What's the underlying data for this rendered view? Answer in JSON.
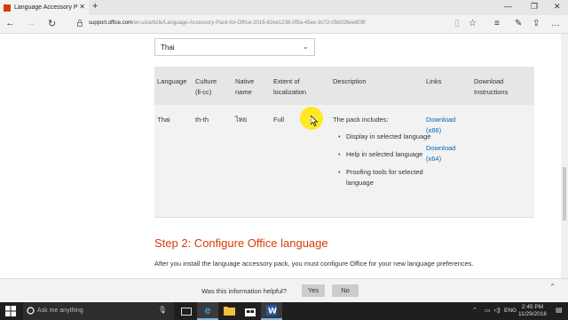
{
  "browser": {
    "tab_title": "Language Accessory Pack",
    "url_domain": "support.office.com",
    "url_path": "/en-us/article/Language-Accessory-Pack-for-Office-2016-82ee1236-0f9a-45ee-9c72-05b026ee809f"
  },
  "page": {
    "language_select": "Thai",
    "table": {
      "headers": [
        "Language",
        "Culture (ll-cc)",
        "Native name",
        "Extent of localization",
        "Description",
        "Links",
        "Download Instructions"
      ],
      "row": {
        "language": "Thai",
        "culture": "th-th",
        "native_name": "ไทย",
        "extent": "Full",
        "description_intro": "The pack includes:",
        "description_items": [
          "Display in selected language",
          "Help in selected language",
          "Proofing tools for selected language"
        ],
        "link_x86": "Download (x86)",
        "link_x64": "Download (x64)"
      }
    },
    "step2_heading": "Step 2: Configure Office language",
    "step2_text": "After you install the language accessory pack, you must configure Office for your new language preferences."
  },
  "feedback": {
    "question": "Was this information helpful?",
    "yes": "Yes",
    "no": "No"
  },
  "taskbar": {
    "search_placeholder": "Ask me anything",
    "language": "ENG",
    "time": "2:45 PM",
    "date": "11/29/2016"
  },
  "colors": {
    "accent_heading": "#d83b01",
    "link": "#0067b8",
    "table_header_bg": "#e6e6e6",
    "table_row_bg": "#f2f2f2",
    "cursor_highlight": "#ffe600"
  }
}
